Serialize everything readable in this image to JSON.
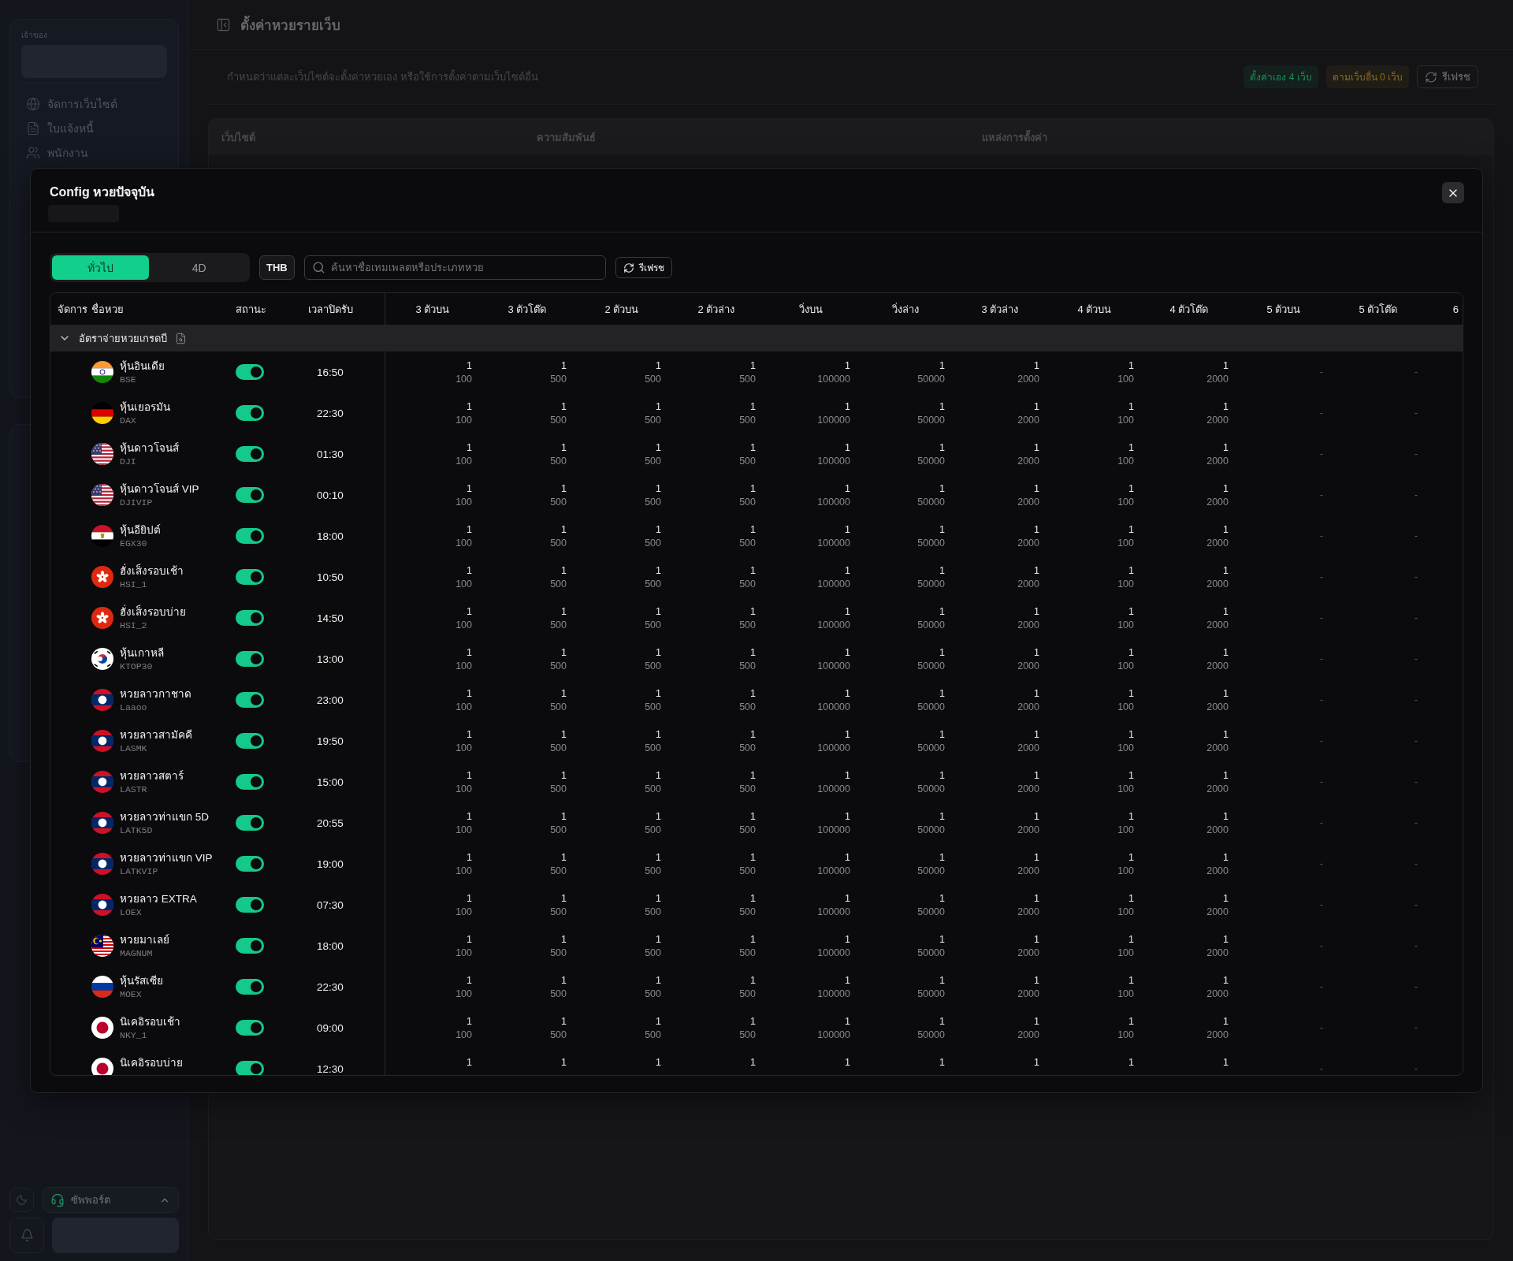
{
  "sidebar": {
    "section_label": "เจ้าของ",
    "items": [
      {
        "label": "จัดการเว็บไซต์",
        "kind": "globe"
      },
      {
        "label": "ใบแจ้งหนี้",
        "kind": "document"
      },
      {
        "label": "พนักงาน",
        "kind": "users"
      }
    ],
    "support": {
      "label": "ซัพพอร์ต"
    }
  },
  "page": {
    "title": "ตั้งค่าหวยรายเว็บ",
    "description": "กำหนดว่าแต่ละเว็บไซต์จะตั้งค่าหวยเอง หรือใช้การตั้งค่าตามเว็บไซต์อื่น",
    "badges": [
      {
        "label": "ตั้งค่าเอง 4 เว็บ",
        "color": "#1f8a5c"
      },
      {
        "label": "ตามเว็บอื่น 0 เว็บ",
        "color": "#8a6d1f"
      }
    ],
    "refresh_button": "รีเฟรช",
    "table_columns": [
      "เว็บไซต์",
      "ความสัมพันธ์",
      "แหล่งการตั้งค่า"
    ]
  },
  "modal": {
    "title": "Config หวยปัจจุบัน",
    "tabs": [
      {
        "label": "ทั่วไป",
        "selected": true
      },
      {
        "label": "4D",
        "selected": false
      }
    ],
    "currency": "THB",
    "search": {
      "placeholder": "ค้นหาชื่อเทมเพลตหรือประเภทหวย"
    },
    "refresh_button": "รีเฟรช",
    "table": {
      "columns": [
        "จัดการ",
        "ชื่อหวย",
        "สถานะ",
        "เวลาปิดรับ",
        "3 ตัวบน",
        "3 ตัวโต๊ด",
        "2 ตัวบน",
        "2 ตัวล่าง",
        "วิ่งบน",
        "วิ่งล่าง",
        "3 ตัวล่าง",
        "4 ตัวบน",
        "4 ตัวโต๊ด",
        "5 ตัวบน",
        "5 ตัวโต๊ด",
        "6"
      ],
      "group": {
        "label": "อัตราจ่ายหวยเกรดบี",
        "expanded": true
      },
      "rows": [
        {
          "name": "หุ้นอินเดีย",
          "code": "BSE",
          "kind": "india",
          "on": true,
          "time": "16:50",
          "values": [
            [
              "1",
              "100"
            ],
            [
              "1",
              "500"
            ],
            [
              "1",
              "500"
            ],
            [
              "1",
              "500"
            ],
            [
              "1",
              "100000"
            ],
            [
              "1",
              "50000"
            ],
            [
              "1",
              "2000"
            ],
            [
              "1",
              "100"
            ],
            [
              "1",
              "2000"
            ],
            "-",
            "-"
          ]
        },
        {
          "name": "หุ้นเยอรมัน",
          "code": "DAX",
          "kind": "germany",
          "on": true,
          "time": "22:30",
          "values": [
            [
              "1",
              "100"
            ],
            [
              "1",
              "500"
            ],
            [
              "1",
              "500"
            ],
            [
              "1",
              "500"
            ],
            [
              "1",
              "100000"
            ],
            [
              "1",
              "50000"
            ],
            [
              "1",
              "2000"
            ],
            [
              "1",
              "100"
            ],
            [
              "1",
              "2000"
            ],
            "-",
            "-"
          ]
        },
        {
          "name": "หุ้นดาวโจนส์",
          "code": "DJI",
          "kind": "usa",
          "on": true,
          "time": "01:30",
          "values": [
            [
              "1",
              "100"
            ],
            [
              "1",
              "500"
            ],
            [
              "1",
              "500"
            ],
            [
              "1",
              "500"
            ],
            [
              "1",
              "100000"
            ],
            [
              "1",
              "50000"
            ],
            [
              "1",
              "2000"
            ],
            [
              "1",
              "100"
            ],
            [
              "1",
              "2000"
            ],
            "-",
            "-"
          ]
        },
        {
          "name": "หุ้นดาวโจนส์ VIP",
          "code": "DJIVIP",
          "kind": "usa",
          "on": true,
          "time": "00:10",
          "values": [
            [
              "1",
              "100"
            ],
            [
              "1",
              "500"
            ],
            [
              "1",
              "500"
            ],
            [
              "1",
              "500"
            ],
            [
              "1",
              "100000"
            ],
            [
              "1",
              "50000"
            ],
            [
              "1",
              "2000"
            ],
            [
              "1",
              "100"
            ],
            [
              "1",
              "2000"
            ],
            "-",
            "-"
          ]
        },
        {
          "name": "หุ้นอียิปต์",
          "code": "EGX30",
          "kind": "egypt",
          "on": true,
          "time": "18:00",
          "values": [
            [
              "1",
              "100"
            ],
            [
              "1",
              "500"
            ],
            [
              "1",
              "500"
            ],
            [
              "1",
              "500"
            ],
            [
              "1",
              "100000"
            ],
            [
              "1",
              "50000"
            ],
            [
              "1",
              "2000"
            ],
            [
              "1",
              "100"
            ],
            [
              "1",
              "2000"
            ],
            "-",
            "-"
          ]
        },
        {
          "name": "ฮั่งเส็งรอบเช้า",
          "code": "HSI_1",
          "kind": "hong_kong",
          "on": true,
          "time": "10:50",
          "values": [
            [
              "1",
              "100"
            ],
            [
              "1",
              "500"
            ],
            [
              "1",
              "500"
            ],
            [
              "1",
              "500"
            ],
            [
              "1",
              "100000"
            ],
            [
              "1",
              "50000"
            ],
            [
              "1",
              "2000"
            ],
            [
              "1",
              "100"
            ],
            [
              "1",
              "2000"
            ],
            "-",
            "-"
          ]
        },
        {
          "name": "ฮั่งเส็งรอบบ่าย",
          "code": "HSI_2",
          "kind": "hong_kong",
          "on": true,
          "time": "14:50",
          "values": [
            [
              "1",
              "100"
            ],
            [
              "1",
              "500"
            ],
            [
              "1",
              "500"
            ],
            [
              "1",
              "500"
            ],
            [
              "1",
              "100000"
            ],
            [
              "1",
              "50000"
            ],
            [
              "1",
              "2000"
            ],
            [
              "1",
              "100"
            ],
            [
              "1",
              "2000"
            ],
            "-",
            "-"
          ]
        },
        {
          "name": "หุ้นเกาหลี",
          "code": "KTOP30",
          "kind": "south_korea",
          "on": true,
          "time": "13:00",
          "values": [
            [
              "1",
              "100"
            ],
            [
              "1",
              "500"
            ],
            [
              "1",
              "500"
            ],
            [
              "1",
              "500"
            ],
            [
              "1",
              "100000"
            ],
            [
              "1",
              "50000"
            ],
            [
              "1",
              "2000"
            ],
            [
              "1",
              "100"
            ],
            [
              "1",
              "2000"
            ],
            "-",
            "-"
          ]
        },
        {
          "name": "หวยลาวกาชาด",
          "code": "Laaoo",
          "kind": "laos",
          "on": true,
          "time": "23:00",
          "values": [
            [
              "1",
              "100"
            ],
            [
              "1",
              "500"
            ],
            [
              "1",
              "500"
            ],
            [
              "1",
              "500"
            ],
            [
              "1",
              "100000"
            ],
            [
              "1",
              "50000"
            ],
            [
              "1",
              "2000"
            ],
            [
              "1",
              "100"
            ],
            [
              "1",
              "2000"
            ],
            "-",
            "-"
          ]
        },
        {
          "name": "หวยลาวสามัคคี",
          "code": "LASMK",
          "kind": "laos",
          "on": true,
          "time": "19:50",
          "values": [
            [
              "1",
              "100"
            ],
            [
              "1",
              "500"
            ],
            [
              "1",
              "500"
            ],
            [
              "1",
              "500"
            ],
            [
              "1",
              "100000"
            ],
            [
              "1",
              "50000"
            ],
            [
              "1",
              "2000"
            ],
            [
              "1",
              "100"
            ],
            [
              "1",
              "2000"
            ],
            "-",
            "-"
          ]
        },
        {
          "name": "หวยลาวสตาร์",
          "code": "LASTR",
          "kind": "laos",
          "on": true,
          "time": "15:00",
          "values": [
            [
              "1",
              "100"
            ],
            [
              "1",
              "500"
            ],
            [
              "1",
              "500"
            ],
            [
              "1",
              "500"
            ],
            [
              "1",
              "100000"
            ],
            [
              "1",
              "50000"
            ],
            [
              "1",
              "2000"
            ],
            [
              "1",
              "100"
            ],
            [
              "1",
              "2000"
            ],
            "-",
            "-"
          ]
        },
        {
          "name": "หวยลาวท่าแขก 5D",
          "code": "LATK5D",
          "kind": "laos",
          "on": true,
          "time": "20:55",
          "values": [
            [
              "1",
              "100"
            ],
            [
              "1",
              "500"
            ],
            [
              "1",
              "500"
            ],
            [
              "1",
              "500"
            ],
            [
              "1",
              "100000"
            ],
            [
              "1",
              "50000"
            ],
            [
              "1",
              "2000"
            ],
            [
              "1",
              "100"
            ],
            [
              "1",
              "2000"
            ],
            "-",
            "-"
          ]
        },
        {
          "name": "หวยลาวท่าแขก VIP",
          "code": "LATKVIP",
          "kind": "laos",
          "on": true,
          "time": "19:00",
          "values": [
            [
              "1",
              "100"
            ],
            [
              "1",
              "500"
            ],
            [
              "1",
              "500"
            ],
            [
              "1",
              "500"
            ],
            [
              "1",
              "100000"
            ],
            [
              "1",
              "50000"
            ],
            [
              "1",
              "2000"
            ],
            [
              "1",
              "100"
            ],
            [
              "1",
              "2000"
            ],
            "-",
            "-"
          ]
        },
        {
          "name": "หวยลาว EXTRA",
          "code": "LOEX",
          "kind": "laos",
          "on": true,
          "time": "07:30",
          "values": [
            [
              "1",
              "100"
            ],
            [
              "1",
              "500"
            ],
            [
              "1",
              "500"
            ],
            [
              "1",
              "500"
            ],
            [
              "1",
              "100000"
            ],
            [
              "1",
              "50000"
            ],
            [
              "1",
              "2000"
            ],
            [
              "1",
              "100"
            ],
            [
              "1",
              "2000"
            ],
            "-",
            "-"
          ]
        },
        {
          "name": "หวยมาเลย์",
          "code": "MAGNUM",
          "kind": "malaysia",
          "on": true,
          "time": "18:00",
          "values": [
            [
              "1",
              "100"
            ],
            [
              "1",
              "500"
            ],
            [
              "1",
              "500"
            ],
            [
              "1",
              "500"
            ],
            [
              "1",
              "100000"
            ],
            [
              "1",
              "50000"
            ],
            [
              "1",
              "2000"
            ],
            [
              "1",
              "100"
            ],
            [
              "1",
              "2000"
            ],
            "-",
            "-"
          ]
        },
        {
          "name": "หุ้นรัสเซีย",
          "code": "MOEX",
          "kind": "russia",
          "on": true,
          "time": "22:30",
          "values": [
            [
              "1",
              "100"
            ],
            [
              "1",
              "500"
            ],
            [
              "1",
              "500"
            ],
            [
              "1",
              "500"
            ],
            [
              "1",
              "100000"
            ],
            [
              "1",
              "50000"
            ],
            [
              "1",
              "2000"
            ],
            [
              "1",
              "100"
            ],
            [
              "1",
              "2000"
            ],
            "-",
            "-"
          ]
        },
        {
          "name": "นิเคอิรอบเช้า",
          "code": "NKY_1",
          "kind": "japan",
          "on": true,
          "time": "09:00",
          "values": [
            [
              "1",
              "100"
            ],
            [
              "1",
              "500"
            ],
            [
              "1",
              "500"
            ],
            [
              "1",
              "500"
            ],
            [
              "1",
              "100000"
            ],
            [
              "1",
              "50000"
            ],
            [
              "1",
              "2000"
            ],
            [
              "1",
              "100"
            ],
            [
              "1",
              "2000"
            ],
            "-",
            "-"
          ]
        },
        {
          "name": "นิเคอิรอบบ่าย",
          "kind": "japan",
          "on": true,
          "time": "12:30",
          "values": [
            [
              "1"
            ],
            [
              "1"
            ],
            [
              "1"
            ],
            [
              "1"
            ],
            [
              "1"
            ],
            [
              "1"
            ],
            [
              "1"
            ],
            [
              "1"
            ],
            [
              "1"
            ],
            "-",
            "-"
          ]
        }
      ]
    }
  }
}
